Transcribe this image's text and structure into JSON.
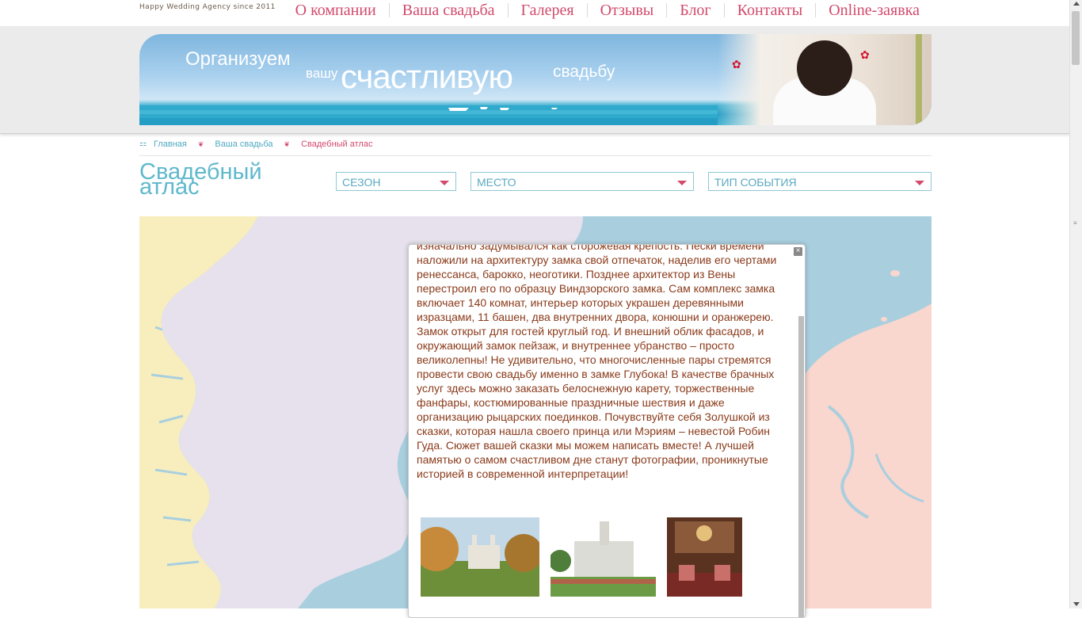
{
  "brand": {
    "tagline": "Happy Wedding Agency since 2011"
  },
  "nav": {
    "items": [
      "О компании",
      "Ваша свадьба",
      "Галерея",
      "Отзывы",
      "Блог",
      "Контакты",
      "Online-заявка"
    ]
  },
  "banner": {
    "slogan_1": "Организуем",
    "slogan_2": "вашу",
    "slogan_3": "счастливую",
    "slogan_4": "свадьбу"
  },
  "breadcrumb": {
    "items": [
      "Главная",
      "Ваша свадьба"
    ],
    "current": "Свадебный атлас"
  },
  "page": {
    "title_line1": "Свадебный",
    "title_line2": "атлас"
  },
  "filters": {
    "season": "СЕЗОН",
    "place": "МЕСТО",
    "event_type": "ТИП СОБЫТИЯ"
  },
  "popup": {
    "text": "изначально задумывался как сторожевая крепость. Пески времени наложили на архитектуру замка свой отпечаток, наделив его чертами ренессанса, барокко, неоготики. Позднее архитектор из Вены перестроил его по образцу Виндзорского замка. Сам комплекс замка включает 140 комнат, интерьер которых украшен деревянными изразцами, 11 башен, два внутренних двора, конюшни и оранжерею. Замок открыт для гостей круглый год. И внешний облик фасадов, и окружающий замок пейзаж, и внутреннее убранство – просто великолепны! Не удивительно, что многочисленные пары стремятся провести свою свадьбу именно в замке Глубока! В качестве брачных услуг здесь можно заказать белоснежную карету, торжественные фанфары, костюмированные праздничные шествия и даже организацию рыцарских поединков. Почувствуйте себя Золушкой из сказки, которая нашла своего принца или Мэриям – невестой Робин Гуда. Сюжет вашей сказки мы можем написать вместе! А лучшей памятью о самом счастливом дне станут фотографии, проникнутые историей в современной интерпретации!"
  },
  "colors": {
    "accent_pink": "#d24a6c",
    "accent_teal": "#5fb8cc",
    "map_sea": "#a9cfdf",
    "map_land_yellow": "#f8eebd",
    "map_land_lavender": "#e6e1ec",
    "map_land_pink": "#f9d6ce",
    "popup_text": "#8a3a1a"
  }
}
